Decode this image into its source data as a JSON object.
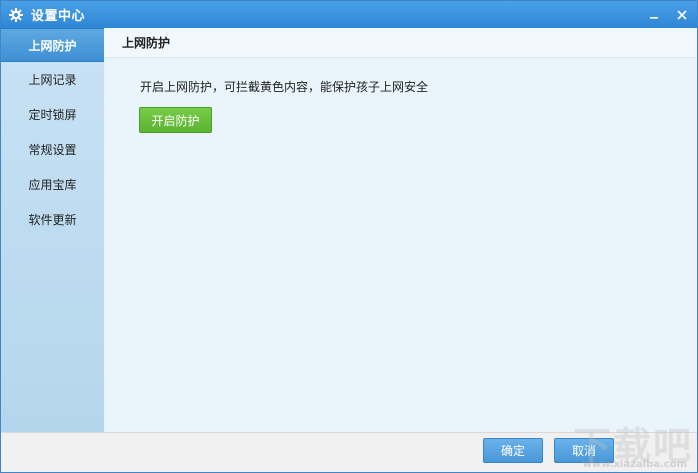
{
  "window": {
    "title": "设置中心"
  },
  "title_controls": {
    "minimize": "-",
    "close": "×"
  },
  "sidebar": {
    "items": [
      {
        "label": "上网防护",
        "active": true
      },
      {
        "label": "上网记录",
        "active": false
      },
      {
        "label": "定时锁屏",
        "active": false
      },
      {
        "label": "常规设置",
        "active": false
      },
      {
        "label": "应用宝库",
        "active": false
      },
      {
        "label": "软件更新",
        "active": false
      }
    ]
  },
  "main": {
    "section_title": "上网防护",
    "description": "开启上网防护，可拦截黄色内容，能保护孩子上网安全",
    "enable_button": "开启防护"
  },
  "footer": {
    "ok": "确定",
    "cancel": "取消"
  },
  "watermark": {
    "text": "下载吧",
    "url": "www.xiazaiba.com"
  },
  "colors": {
    "accent": "#3f8fd3",
    "green": "#5cb332",
    "sidebar": "#c8e2f4"
  }
}
